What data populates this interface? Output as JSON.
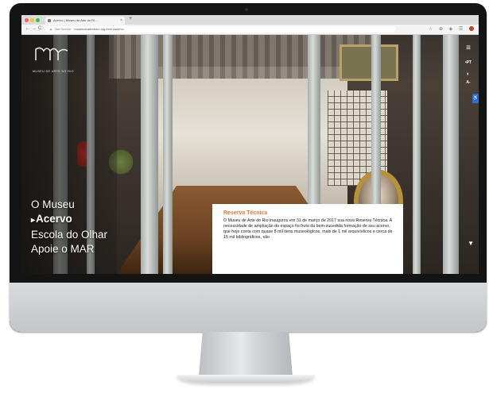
{
  "browser": {
    "tab_title": "Acervo | Museu de Arte do Ri…",
    "tab_close": "×",
    "new_tab": "+",
    "nav_back": "←",
    "nav_forward": "→",
    "nav_reload": "C",
    "url_lock": "▲",
    "url_secure_label": "Not Secure",
    "url": "museudeartedorio.org.br/en/acervo",
    "extension_icons": "☆ ⊕ ◈ ☰"
  },
  "site": {
    "logo_text": "MAR",
    "logo_subtitle": "MUSEU DE ARTE DO RIO",
    "nav": [
      {
        "label": "O Museu",
        "active": false
      },
      {
        "label": "Acervo",
        "active": true
      },
      {
        "label": "Escola do Olhar",
        "active": false
      },
      {
        "label": "Apoie o MAR",
        "active": false
      }
    ],
    "right_controls": {
      "menu_icon": "≡",
      "language": "•PT",
      "contrast_icon": "◐",
      "font_size": "A-",
      "accessibility_icon": "♿",
      "scroll_down_icon": "▼"
    },
    "info_card": {
      "title": "Reserva Técnica",
      "body": "O Museu de Arte do Rio inaugurou em 31 de março de 2017 sua nova Reserva Técnica. A necessidade de ampliação do espaço foi fruto da bem-sucedida formação de seu acervo, que hoje conta com quase 8 mil itens museológicos, mais de 1 mil arquivísticos e cerca de 15 mil bibliográficos, são"
    }
  },
  "colors": {
    "accent_orange": "#e07a3a",
    "accessibility_blue": "#2f6fd0",
    "monitor_bezel": "#141414"
  }
}
